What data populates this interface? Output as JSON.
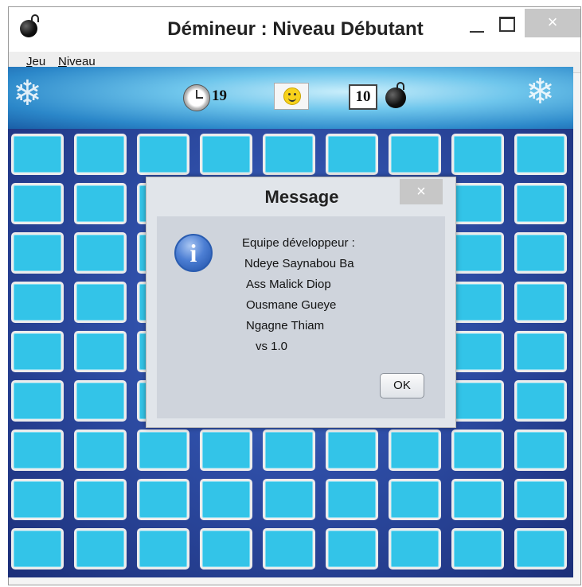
{
  "window": {
    "title": "Démineur : Niveau Débutant",
    "close_symbol": "×",
    "icons": [
      "bomb-icon",
      "minimize-icon",
      "maximize-icon",
      "close-icon"
    ]
  },
  "menu": {
    "items": [
      {
        "label": "Jeu",
        "mnemonic": "J",
        "rest": "eu"
      },
      {
        "label": "Niveau",
        "mnemonic": "N",
        "rest": "iveau"
      }
    ]
  },
  "header": {
    "timer": "19",
    "mines_remaining": "10",
    "smiley": "smiley-face-icon",
    "clock": "clock-icon"
  },
  "board": {
    "columns": 9,
    "rows": 9,
    "cell_state": "unrevealed",
    "cell_color": "#33c4e8",
    "background_color": "#2f4fa8"
  },
  "dialog": {
    "title": "Message",
    "close_symbol": "×",
    "icon": "info-icon",
    "icon_glyph": "i",
    "lines": [
      "Equipe développeur :",
      "Ndeye Saynabou Ba",
      "Ass Malick Diop",
      "Ousmane Gueye",
      "Ngagne Thiam",
      "vs 1.0"
    ],
    "ok_label": "OK"
  }
}
